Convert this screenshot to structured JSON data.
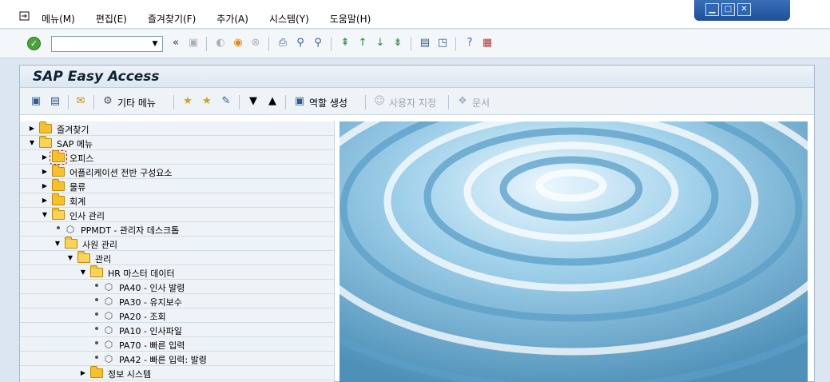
{
  "menubar": {
    "items": [
      "메뉴(M)",
      "편집(E)",
      "즐겨찾기(F)",
      "추가(A)",
      "시스템(Y)",
      "도움말(H)"
    ],
    "window_controls": [
      "minimize",
      "maximize",
      "close"
    ]
  },
  "std_toolbar": {
    "command_field_value": "",
    "icons": [
      "enter-icon",
      "save-icon",
      "back-icon",
      "exit-icon",
      "cancel-icon",
      "print-icon",
      "find-icon",
      "find-next-icon",
      "first-page-icon",
      "prev-page-icon",
      "next-page-icon",
      "last-page-icon",
      "new-session-icon",
      "shortcut-icon",
      "help-icon",
      "layout-icon"
    ]
  },
  "title": "SAP Easy Access",
  "app_toolbar": {
    "other_menu": "기타 메뉴",
    "create_role": "역할 생성",
    "assign_user": "사용자 지정",
    "documentation": "문서"
  },
  "tree": {
    "nodes": [
      {
        "label": "즐겨찾기",
        "type": "folder",
        "level": 0,
        "expanded": false
      },
      {
        "label": "SAP 메뉴",
        "type": "folder",
        "level": 0,
        "expanded": true
      },
      {
        "label": "오피스",
        "type": "folder",
        "level": 1,
        "expanded": false,
        "selected": true
      },
      {
        "label": "어플리케이션 전반 구성요소",
        "type": "folder",
        "level": 1,
        "expanded": false
      },
      {
        "label": "물류",
        "type": "folder",
        "level": 1,
        "expanded": false
      },
      {
        "label": "회계",
        "type": "folder",
        "level": 1,
        "expanded": false
      },
      {
        "label": "인사 관리",
        "type": "folder",
        "level": 1,
        "expanded": true
      },
      {
        "label": "PPMDT - 관리자 데스크톱",
        "type": "transaction",
        "level": 2
      },
      {
        "label": "사원 관리",
        "type": "folder",
        "level": 2,
        "expanded": true
      },
      {
        "label": "관리",
        "type": "folder",
        "level": 3,
        "expanded": true
      },
      {
        "label": "HR 마스터 데이터",
        "type": "folder",
        "level": 4,
        "expanded": true
      },
      {
        "label": "PA40 - 인사 발령",
        "type": "transaction",
        "level": 5
      },
      {
        "label": "PA30 - 유지보수",
        "type": "transaction",
        "level": 5
      },
      {
        "label": "PA20 - 조회",
        "type": "transaction",
        "level": 5
      },
      {
        "label": "PA10 - 인사파일",
        "type": "transaction",
        "level": 5
      },
      {
        "label": "PA70 - 빠른 입력",
        "type": "transaction",
        "level": 5
      },
      {
        "label": "PA42 - 빠른 입력: 발령",
        "type": "transaction",
        "level": 5
      },
      {
        "label": "정보 시스템",
        "type": "folder",
        "level": 4,
        "expanded": false
      }
    ]
  },
  "colors": {
    "background": "#dce6f0",
    "tree_background": "#eef3f8",
    "folder": "#f6c12a",
    "ok_green": "#4aa23a",
    "title_bar": "#1e4f9a"
  }
}
